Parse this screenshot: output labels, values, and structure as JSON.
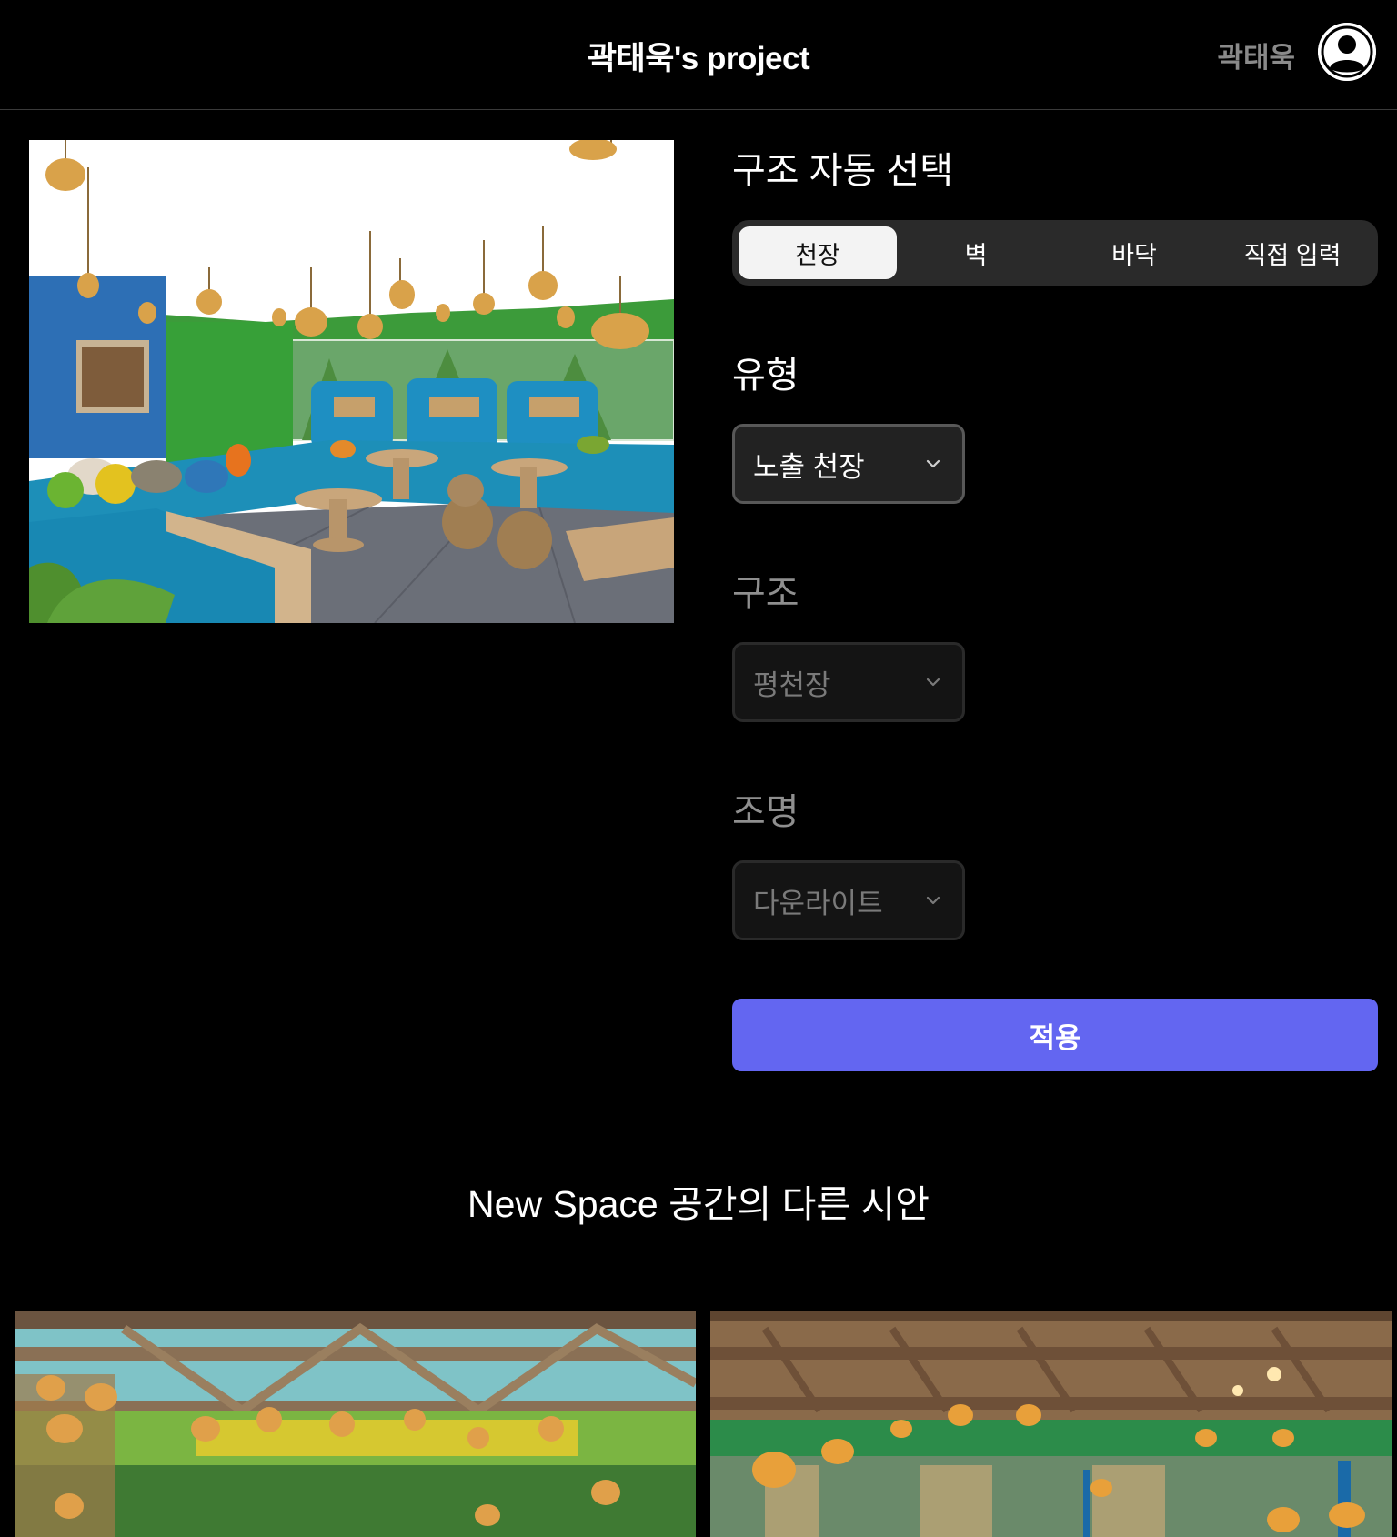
{
  "header": {
    "project_title": "곽태욱's project",
    "user_name": "곽태욱",
    "avatar_icon": "user-avatar-icon"
  },
  "preview": {
    "image_description_icon": "cafe-interior-image"
  },
  "structure_select": {
    "title": "구조 자동 선택",
    "tabs": [
      {
        "label": "천장",
        "active": true
      },
      {
        "label": "벽",
        "active": false
      },
      {
        "label": "바닥",
        "active": false
      },
      {
        "label": "직접 입력",
        "active": false
      }
    ]
  },
  "fields": {
    "type": {
      "label": "유형",
      "value": "노출 천장",
      "enabled": true
    },
    "structure": {
      "label": "구조",
      "value": "평천장",
      "enabled": false
    },
    "lighting": {
      "label": "조명",
      "value": "다운라이트",
      "enabled": false
    }
  },
  "apply_button": {
    "label": "적용"
  },
  "alternatives": {
    "title": "New Space 공간의 다른 시안"
  },
  "colors": {
    "accent": "#6366f1",
    "background": "#000000",
    "segment_bg": "#2a2a2a"
  }
}
